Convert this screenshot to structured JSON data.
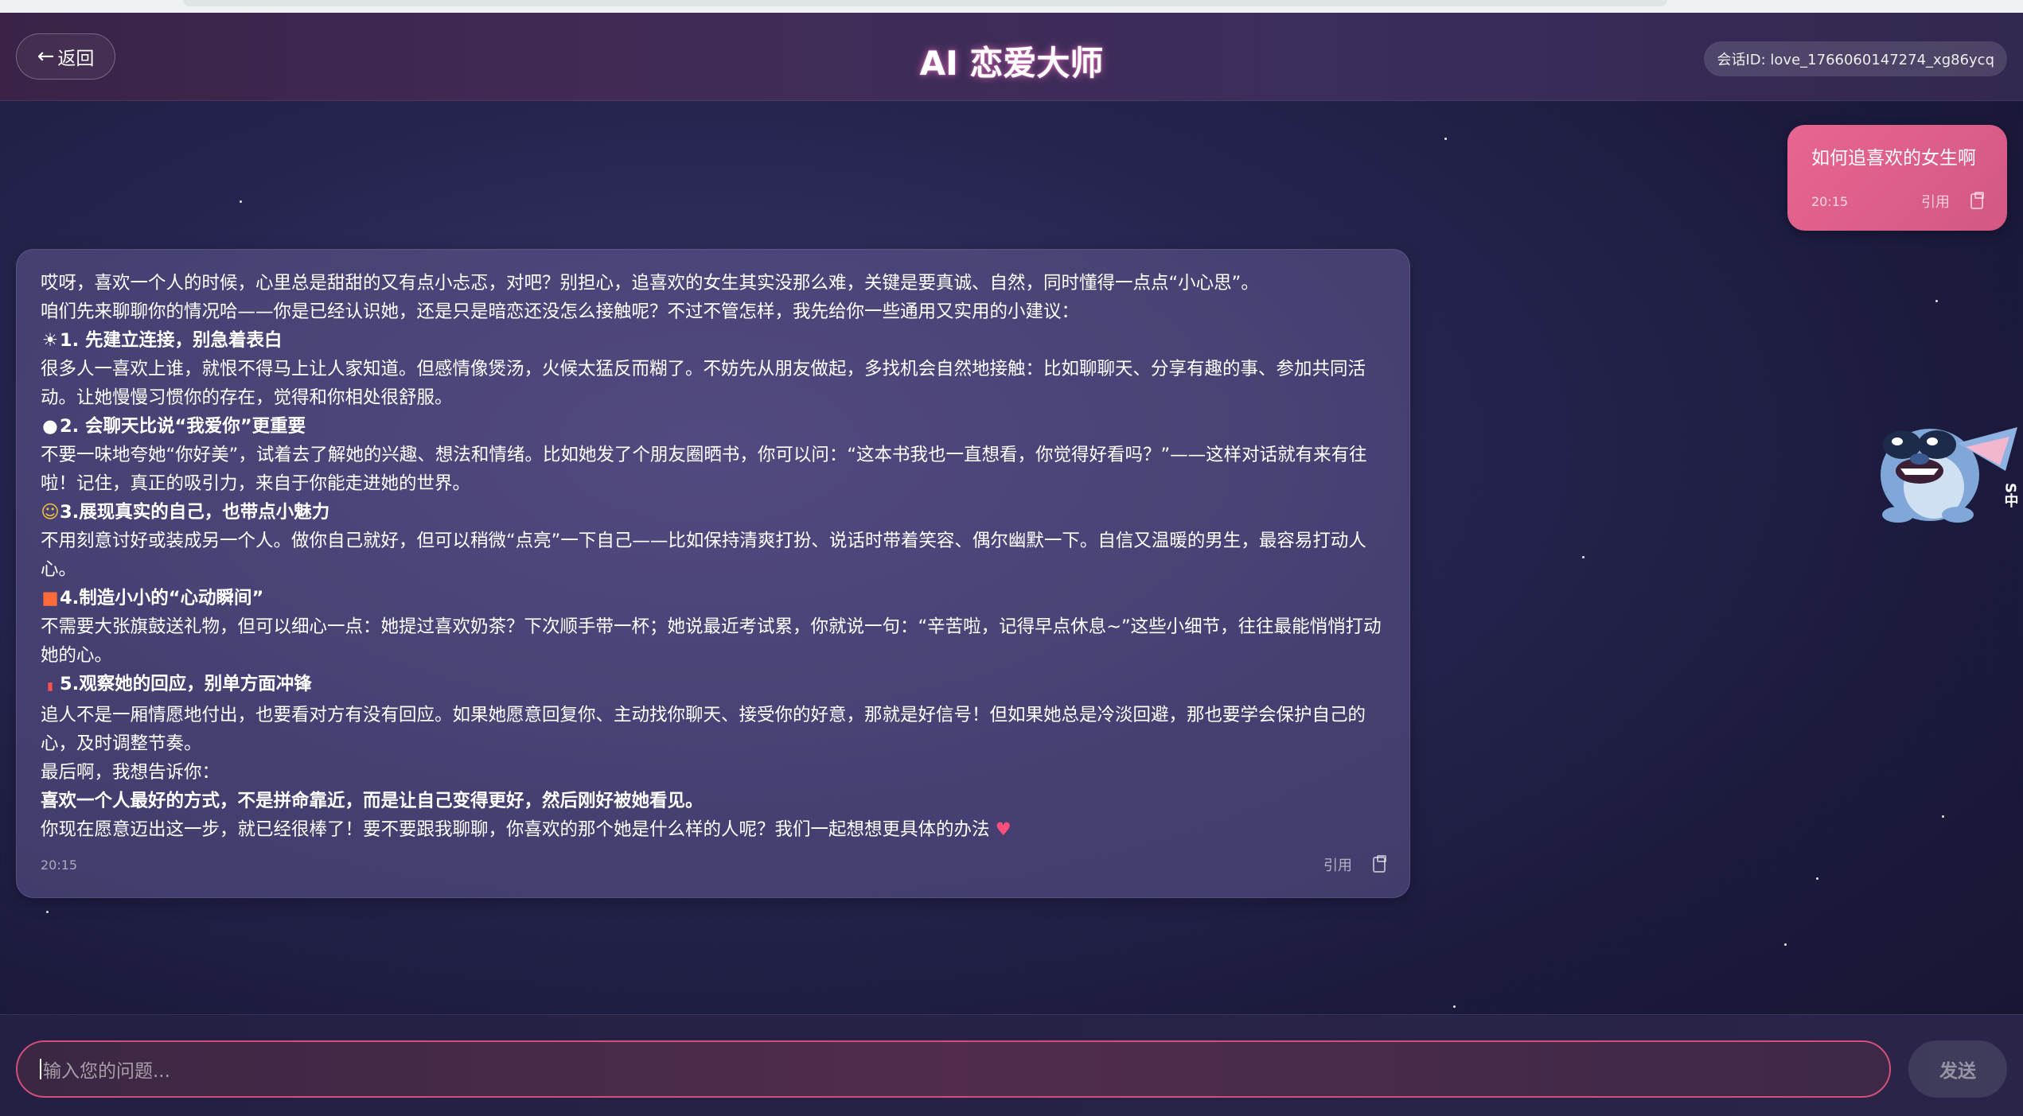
{
  "header": {
    "back_label": "返回",
    "title": "AI 恋爱大师",
    "session_id": "会话ID: love_1766060147274_xg86ycq"
  },
  "messages": {
    "user": {
      "text": "如何追喜欢的女生啊",
      "time": "20:15",
      "quote_label": "引用"
    },
    "ai": {
      "time": "20:15",
      "quote_label": "引用",
      "lines": {
        "l1": "哎呀，喜欢一个人的时候，心里总是甜甜的又有点小忐忑，对吧？别担心，追喜欢的女生其实没那么难，关键是要真诚、自然，同时懂得一点点“小心思”。",
        "l2": "咱们先来聊聊你的情况哈——你是已经认识她，还是只是暗恋还没怎么接触呢？不过不管怎样，我先给你一些通用又实用的小建议：",
        "h1": "1. 先建立连接，别急着表白",
        "p1": "很多人一喜欢上谁，就恨不得马上让人家知道。但感情像煲汤，火候太猛反而糊了。不妨先从朋友做起，多找机会自然地接触：比如聊聊天、分享有趣的事、参加共同活动。让她慢慢习惯你的存在，觉得和你相处很舒服。",
        "h2": "2. 会聊天比说“我爱你”更重要",
        "p2": "不要一味地夸她“你好美”，试着去了解她的兴趣、想法和情绪。比如她发了个朋友圈晒书，你可以问：“这本书我也一直想看，你觉得好看吗？”——这样对话就有来有往啦！记住，真正的吸引力，来自于你能走进她的世界。",
        "h3": "3.展现真实的自己，也带点小魅力",
        "p3": "不用刻意讨好或装成另一个人。做你自己就好，但可以稍微“点亮”一下自己——比如保持清爽打扮、说话时带着笑容、偶尔幽默一下。自信又温暖的男生，最容易打动人心。",
        "h4": "4.制造小小的“心动瞬间”",
        "p4": "不需要大张旗鼓送礼物，但可以细心一点：她提过喜欢奶茶？下次顺手带一杯；她说最近考试累，你就说一句：“辛苦啦，记得早点休息~”这些小细节，往往最能悄悄打动她的心。",
        "h5": "5.观察她的回应，别单方面冲锋",
        "p5": "追人不是一厢情愿地付出，也要看对方有没有回应。如果她愿意回复你、主动找你聊天、接受你的好意，那就是好信号！但如果她总是冷淡回避，那也要学会保护自己的心，及时调整节奏。",
        "l3": "最后啊，我想告诉你：",
        "l4": "喜欢一个人最好的方式，不是拼命靠近，而是让自己变得更好，然后刚好被她看见。",
        "l5": "你现在愿意迈出这一步，就已经很棒了！要不要跟我聊聊，你喜欢的那个她是什么样的人呢？我们一起想想更具体的办法"
      }
    }
  },
  "input": {
    "placeholder": "输入您的问题...",
    "send_label": "发送"
  },
  "mascot_side_text": "S中"
}
